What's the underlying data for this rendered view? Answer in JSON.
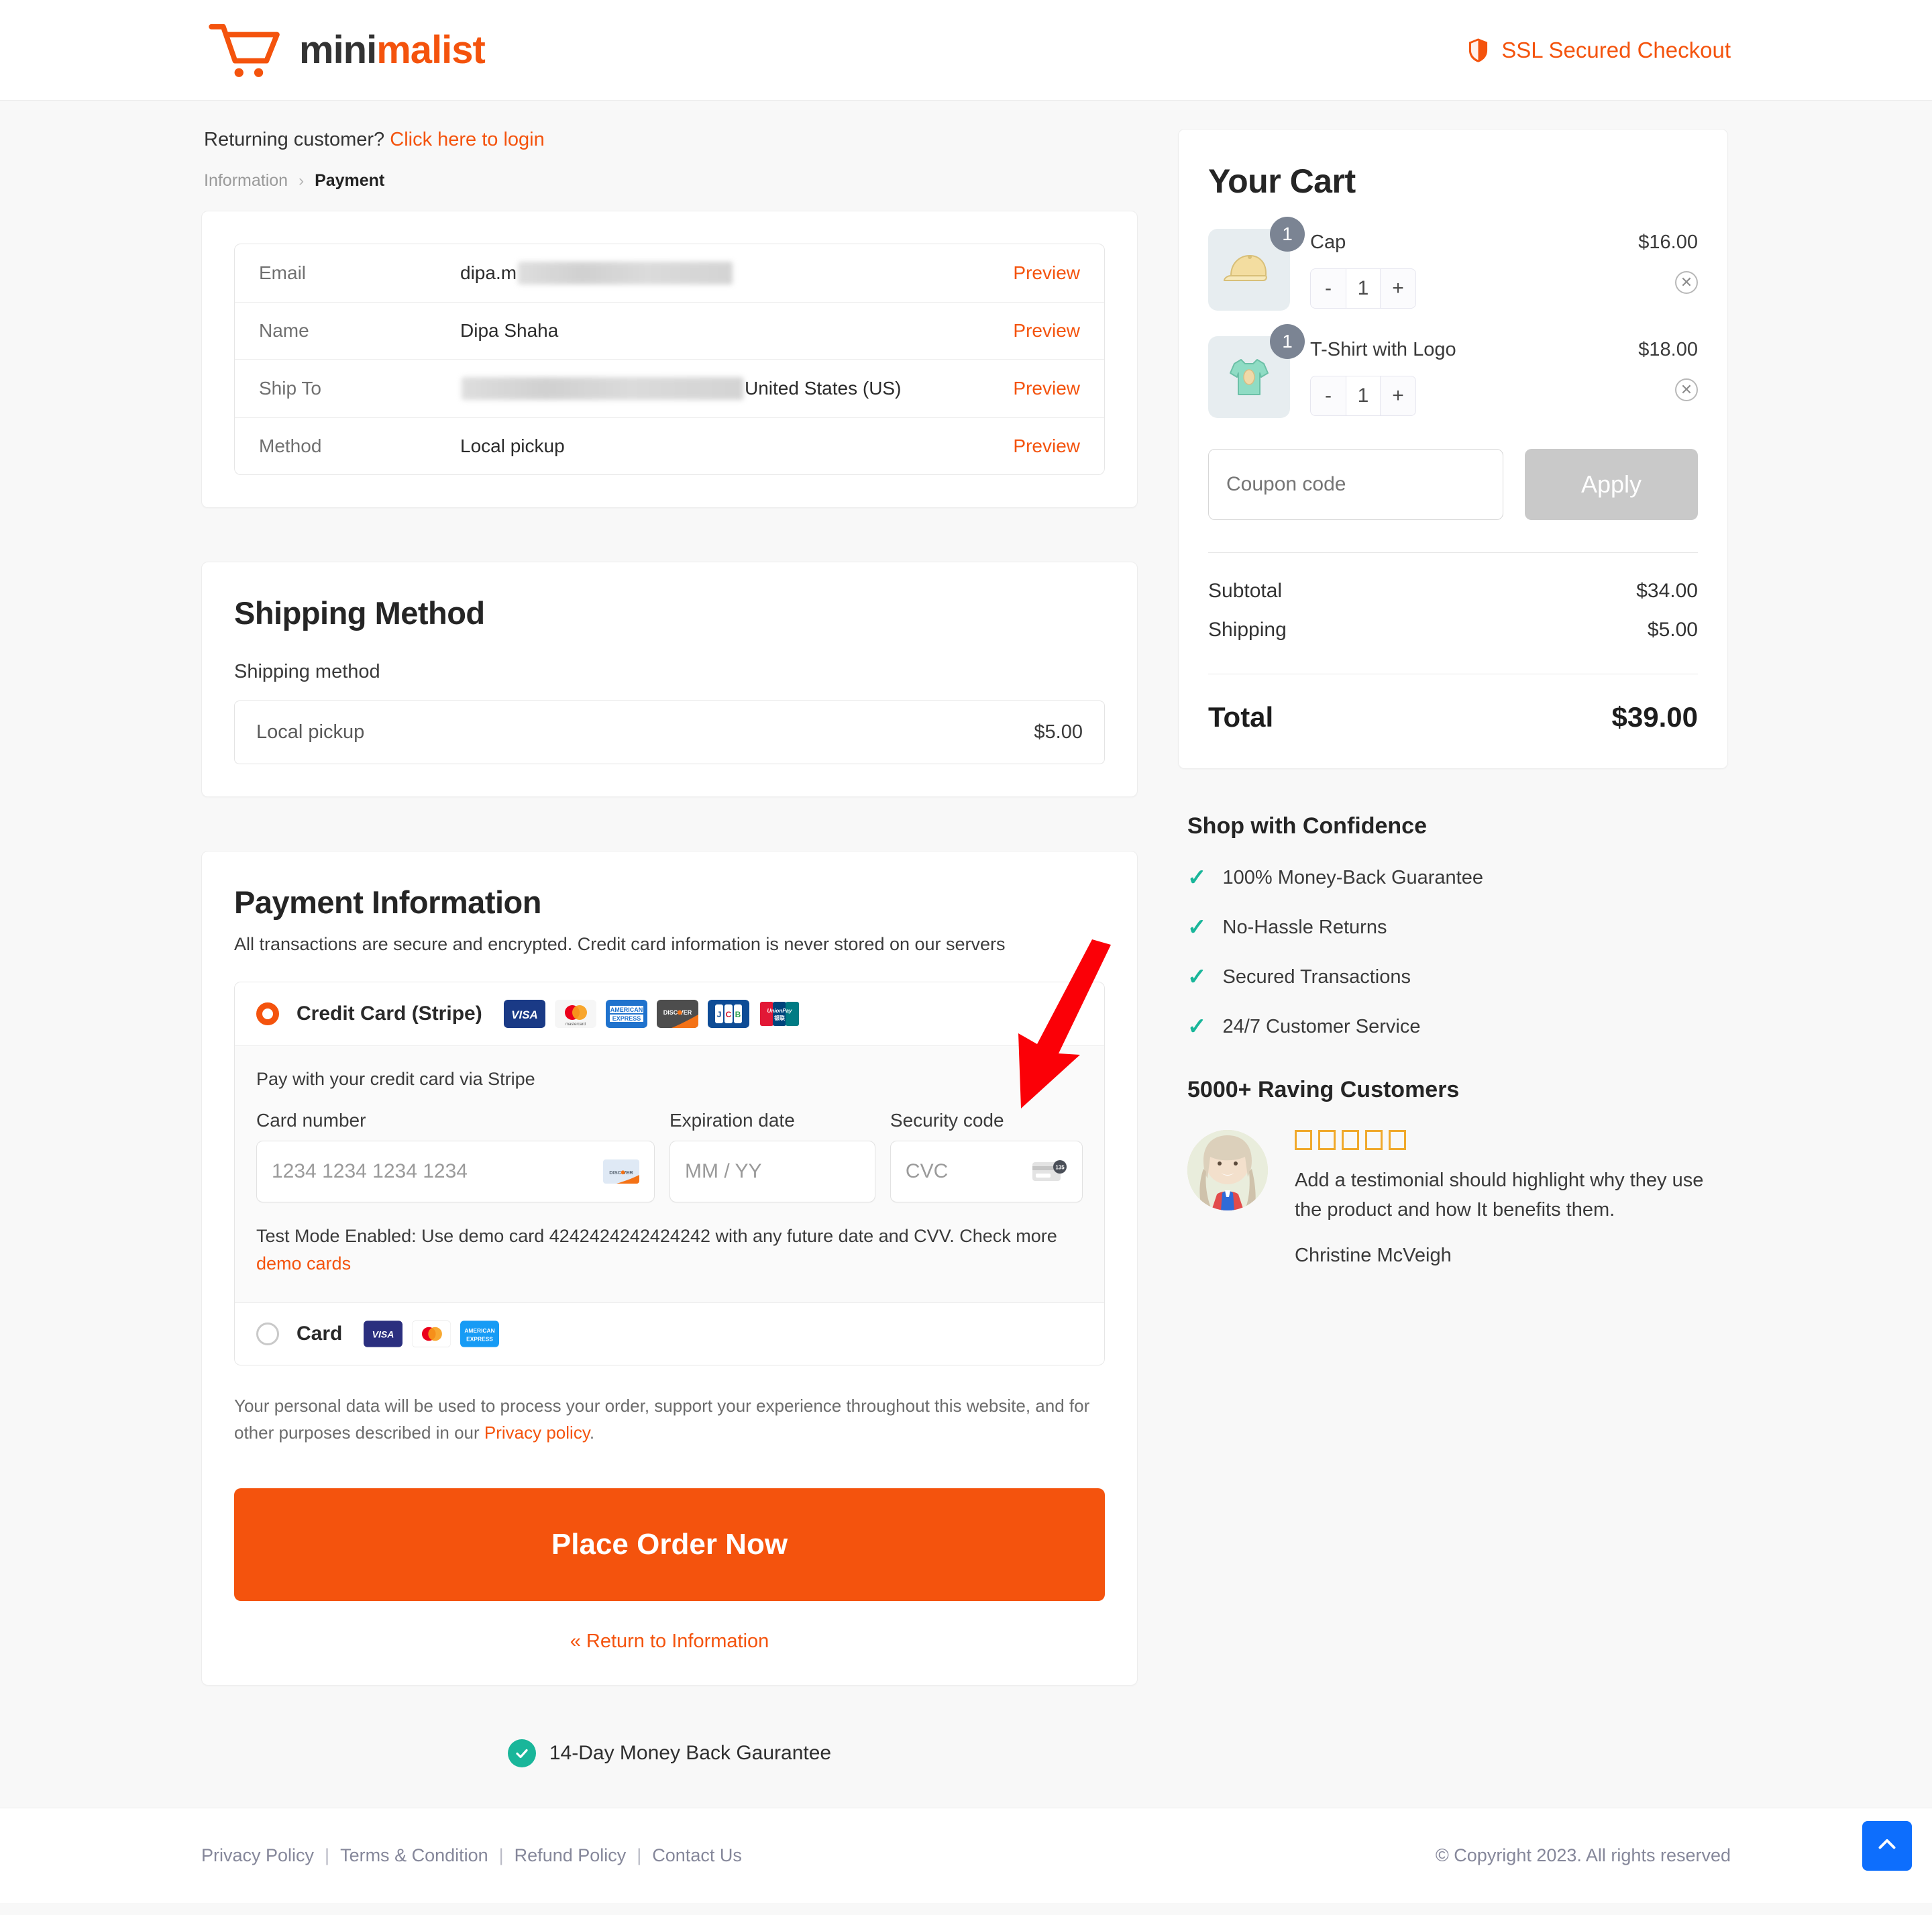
{
  "header": {
    "brand_dark": "mini",
    "brand_accent": "malist",
    "cart_icon": "shopping-cart-icon",
    "ssl_text": "SSL Secured Checkout",
    "ssl_icon": "shield-icon",
    "accent_color": "#f4530d"
  },
  "account": {
    "returning_text": "Returning customer?",
    "login_link": "Click here to login"
  },
  "breadcrumb": {
    "step1": "Information",
    "separator": "›",
    "step2": "Payment"
  },
  "info_table": {
    "preview_label": "Preview",
    "rows": [
      {
        "label": "Email",
        "value": "dipa.m",
        "redacted": true,
        "redacted_width": 180,
        "suffix": ""
      },
      {
        "label": "Name",
        "value": "Dipa  Shaha",
        "redacted": false,
        "redacted_width": 0,
        "suffix": ""
      },
      {
        "label": "Ship To",
        "value": "",
        "redacted": true,
        "redacted_width": 420,
        "suffix": "United States (US)"
      },
      {
        "label": "Method",
        "value": "Local pickup",
        "redacted": false,
        "redacted_width": 0,
        "suffix": ""
      }
    ]
  },
  "shipping": {
    "title": "Shipping Method",
    "subtitle": "Shipping method",
    "option_name": "Local pickup",
    "option_price": "$5.00"
  },
  "payment": {
    "title": "Payment Information",
    "description": "All transactions are secure and encrypted. Credit card information is never stored on our servers",
    "option_stripe_label": "Credit Card (Stripe)",
    "option_stripe_icons": [
      "visa-icon",
      "mastercard-icon",
      "amex-icon",
      "discover-icon",
      "jcb-icon",
      "unionpay-icon"
    ],
    "option_card_label": "Card",
    "option_card_icons": [
      "visa-icon",
      "mastercard-icon",
      "amex-icon"
    ],
    "stripe_lead": "Pay with your credit card via Stripe",
    "card_number_label": "Card number",
    "card_number_placeholder": "1234 1234 1234 1234",
    "card_number_value": "",
    "card_brand_icon": "discover-icon",
    "expiry_label": "Expiration date",
    "expiry_placeholder": "MM / YY",
    "expiry_value": "",
    "cvc_label": "Security code",
    "cvc_placeholder": "CVC",
    "cvc_value": "",
    "cvc_icon": "cvc-card-icon",
    "cvc_icon_number": "135",
    "test_note": "Test Mode Enabled: Use demo card 4242424242424242 with any future date and CVV. Check more",
    "demo_cards_link": "demo cards",
    "privacy_note": "Your personal data will be used to process your order, support your experience throughout this website, and for other purposes described in our ",
    "privacy_link": "Privacy policy",
    "privacy_note_end": ".",
    "place_order_label": "Place Order Now",
    "return_link": "« Return to Information"
  },
  "guarantee": {
    "text": "14-Day Money Back Gaurantee",
    "icon": "check-circle-icon",
    "color": "#19b69a"
  },
  "cart": {
    "title": "Your Cart",
    "items": [
      {
        "name": "Cap",
        "price": "$16.00",
        "qty": "1",
        "badge": "1",
        "thumb_icon": "cap-thumbnail",
        "minus": "-",
        "plus": "+",
        "remove": "✕"
      },
      {
        "name": "T-Shirt with Logo",
        "price": "$18.00",
        "qty": "1",
        "badge": "1",
        "thumb_icon": "tshirt-thumbnail",
        "minus": "-",
        "plus": "+",
        "remove": "✕"
      }
    ],
    "coupon_placeholder": "Coupon code",
    "coupon_value": "",
    "apply_label": "Apply",
    "subtotal_label": "Subtotal",
    "subtotal_value": "$34.00",
    "shipping_label": "Shipping",
    "shipping_value": "$5.00",
    "total_label": "Total",
    "total_value": "$39.00"
  },
  "confidence": {
    "title": "Shop with Confidence",
    "items": [
      "100% Money-Back Guarantee",
      "No-Hassle Returns",
      "Secured Transactions",
      "24/7 Customer Service"
    ],
    "tick": "✓"
  },
  "testimonial": {
    "title": "5000+ Raving Customers",
    "stars": 5,
    "text": "Add a testimonial should highlight why they use the product and how It benefits them.",
    "author": "Christine McVeigh",
    "avatar_icon": "customer-avatar"
  },
  "footer": {
    "links": [
      "Privacy Policy",
      "Terms & Condition",
      "Refund Policy",
      "Contact Us"
    ],
    "separator": "|",
    "copyright": "© Copyright 2023. All rights reserved",
    "scroll_top_icon": "chevron-up-icon"
  },
  "annotation": {
    "type": "red-arrow",
    "color": "#fb0007"
  }
}
